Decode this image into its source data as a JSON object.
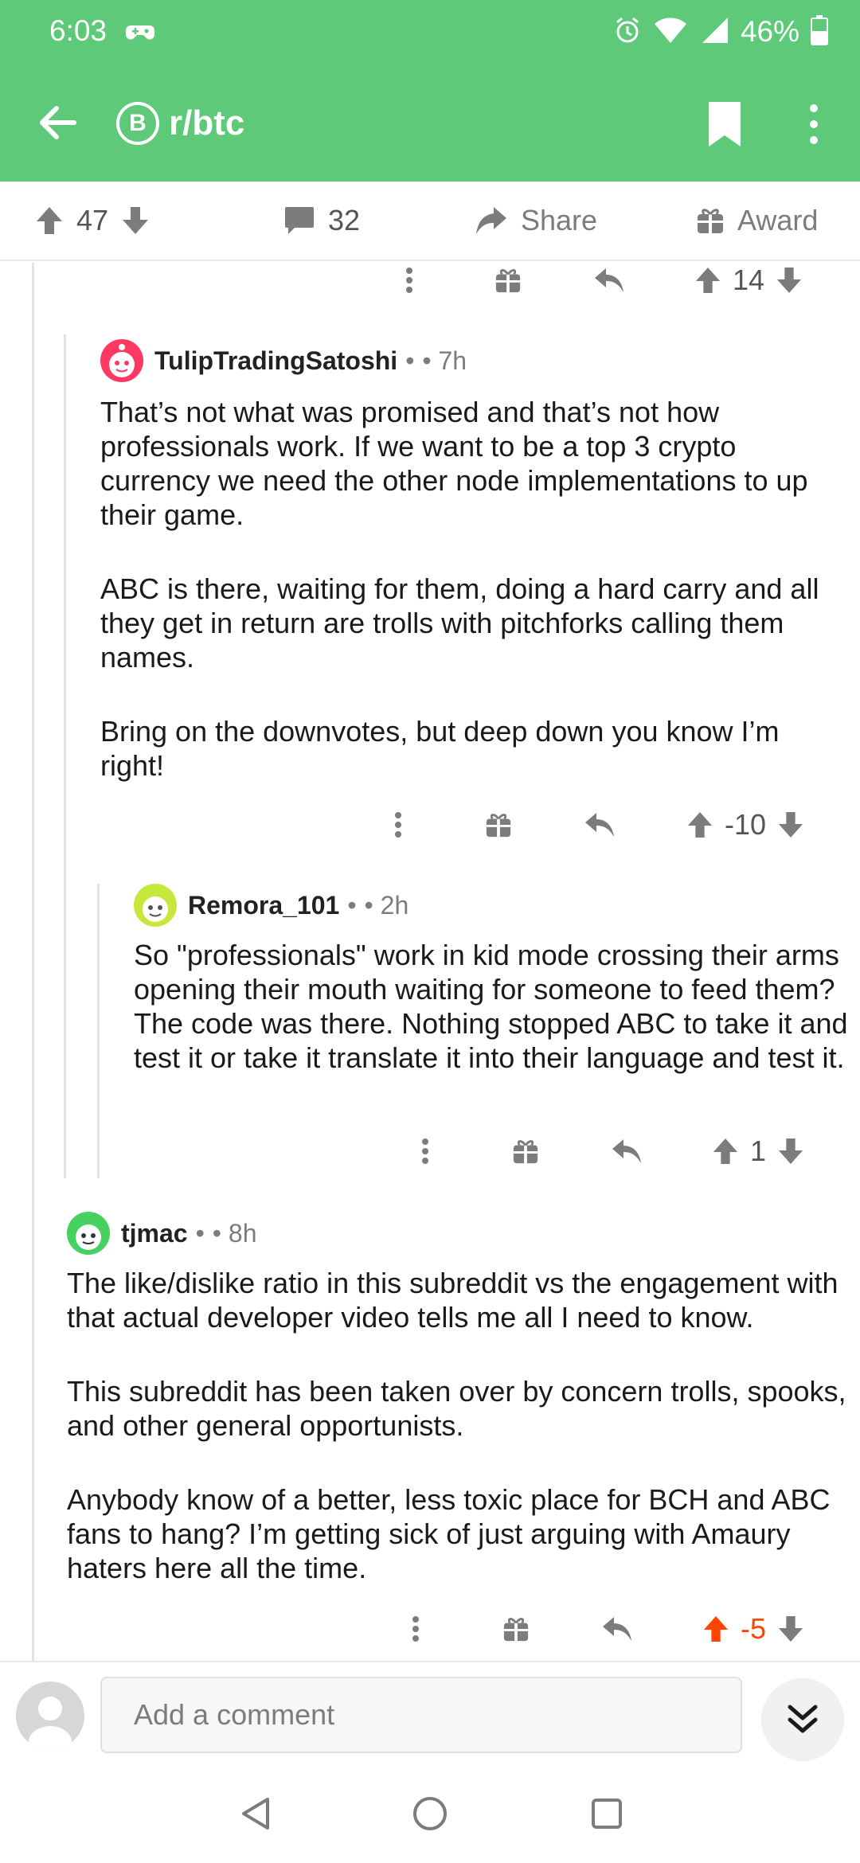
{
  "status_bar": {
    "time": "6:03",
    "battery": "46%"
  },
  "header": {
    "subreddit": "r/btc",
    "sub_icon_letter": "B"
  },
  "action_bar": {
    "upvotes": "47",
    "comments": "32",
    "share_label": "Share",
    "award_label": "Award"
  },
  "top_fragment": {
    "score": "14"
  },
  "comments": [
    {
      "author": "TulipTradingSatoshi",
      "sep": "•",
      "age": "• 7h",
      "paragraphs": [
        "That’s not what was promised and that’s not how professionals work. If we want to be a top 3 crypto currency we need the other node implementations to up their game.",
        "ABC is there, waiting for them, doing a hard carry and all they get in return are trolls with pitchforks calling them names.",
        "Bring on the downvotes, but deep down you know I’m right!"
      ],
      "score": "-10"
    },
    {
      "author": "Remora_101",
      "sep": "•",
      "age": "• 2h",
      "paragraphs": [
        "So \"professionals\" work in kid mode crossing their arms opening their mouth waiting for someone to feed them? The code was there. Nothing stopped ABC to take it and test it or take it translate it into their language and test it."
      ],
      "score": "1"
    },
    {
      "author": "tjmac",
      "sep": "•",
      "age": "• 8h",
      "paragraphs": [
        "The like/dislike ratio in this subreddit vs the engagement with that actual developer video tells me all I need to know.",
        "This subreddit has been taken over by concern trolls, spooks, and other general opportunists.",
        "Anybody know of a better, less toxic place for BCH and ABC fans to hang? I’m getting sick of just arguing with Amaury haters here all the time."
      ],
      "score": "-5"
    }
  ],
  "composer": {
    "placeholder": "Add a comment"
  },
  "colors": {
    "header_green": "#5ec978",
    "upvoted_orange": "#ff4500",
    "icon_gray": "#7c7c7c"
  },
  "icons": [
    "back-arrow-icon",
    "bitcoin-icon",
    "bookmark-icon",
    "more-vertical-icon",
    "upvote-icon",
    "downvote-icon",
    "comment-icon",
    "share-icon",
    "gift-icon",
    "reply-icon",
    "jump-down-icon"
  ]
}
